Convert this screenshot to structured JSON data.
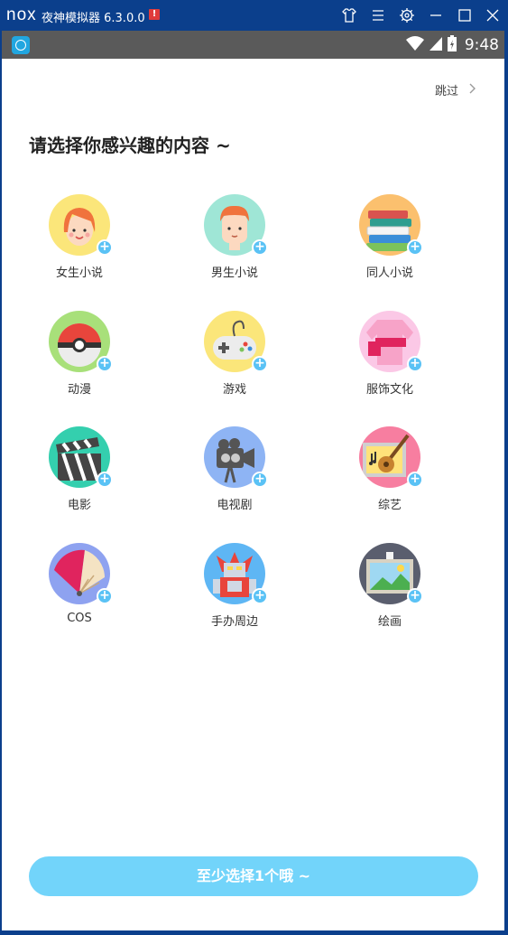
{
  "emulator": {
    "logo": "nox",
    "title": "夜神模拟器 6.3.0.0",
    "warning": "!",
    "controls": [
      "shirt-icon",
      "menu-icon",
      "gear-icon",
      "minimize-icon",
      "maximize-icon",
      "close-icon"
    ]
  },
  "statusbar": {
    "time": "9:48"
  },
  "page": {
    "skip_label": "跳过",
    "title": "请选择你感兴趣的内容 ~",
    "cta_label": "至少选择1个哦 ~"
  },
  "categories": [
    {
      "label": "女生小说",
      "icon": "girl-face-icon",
      "bg": "#fbe67a"
    },
    {
      "label": "男生小说",
      "icon": "boy-face-icon",
      "bg": "#9fe6d6"
    },
    {
      "label": "同人小说",
      "icon": "books-icon",
      "bg": "#fbc06e"
    },
    {
      "label": "动漫",
      "icon": "pokeball-icon",
      "bg": "#a8e07a"
    },
    {
      "label": "游戏",
      "icon": "gamepad-icon",
      "bg": "#fbe67a"
    },
    {
      "label": "服饰文化",
      "icon": "clothes-icon",
      "bg": "#fbc8e6"
    },
    {
      "label": "电影",
      "icon": "clapperboard-icon",
      "bg": "#34cfae"
    },
    {
      "label": "电视剧",
      "icon": "video-camera-icon",
      "bg": "#8eb4f4"
    },
    {
      "label": "综艺",
      "icon": "guitar-icon",
      "bg": "#f77ea0"
    },
    {
      "label": "COS",
      "icon": "fan-icon",
      "bg": "#8ea2f0"
    },
    {
      "label": "手办周边",
      "icon": "robot-icon",
      "bg": "#5eb6f4"
    },
    {
      "label": "绘画",
      "icon": "painting-icon",
      "bg": "#5a5e6e"
    }
  ]
}
